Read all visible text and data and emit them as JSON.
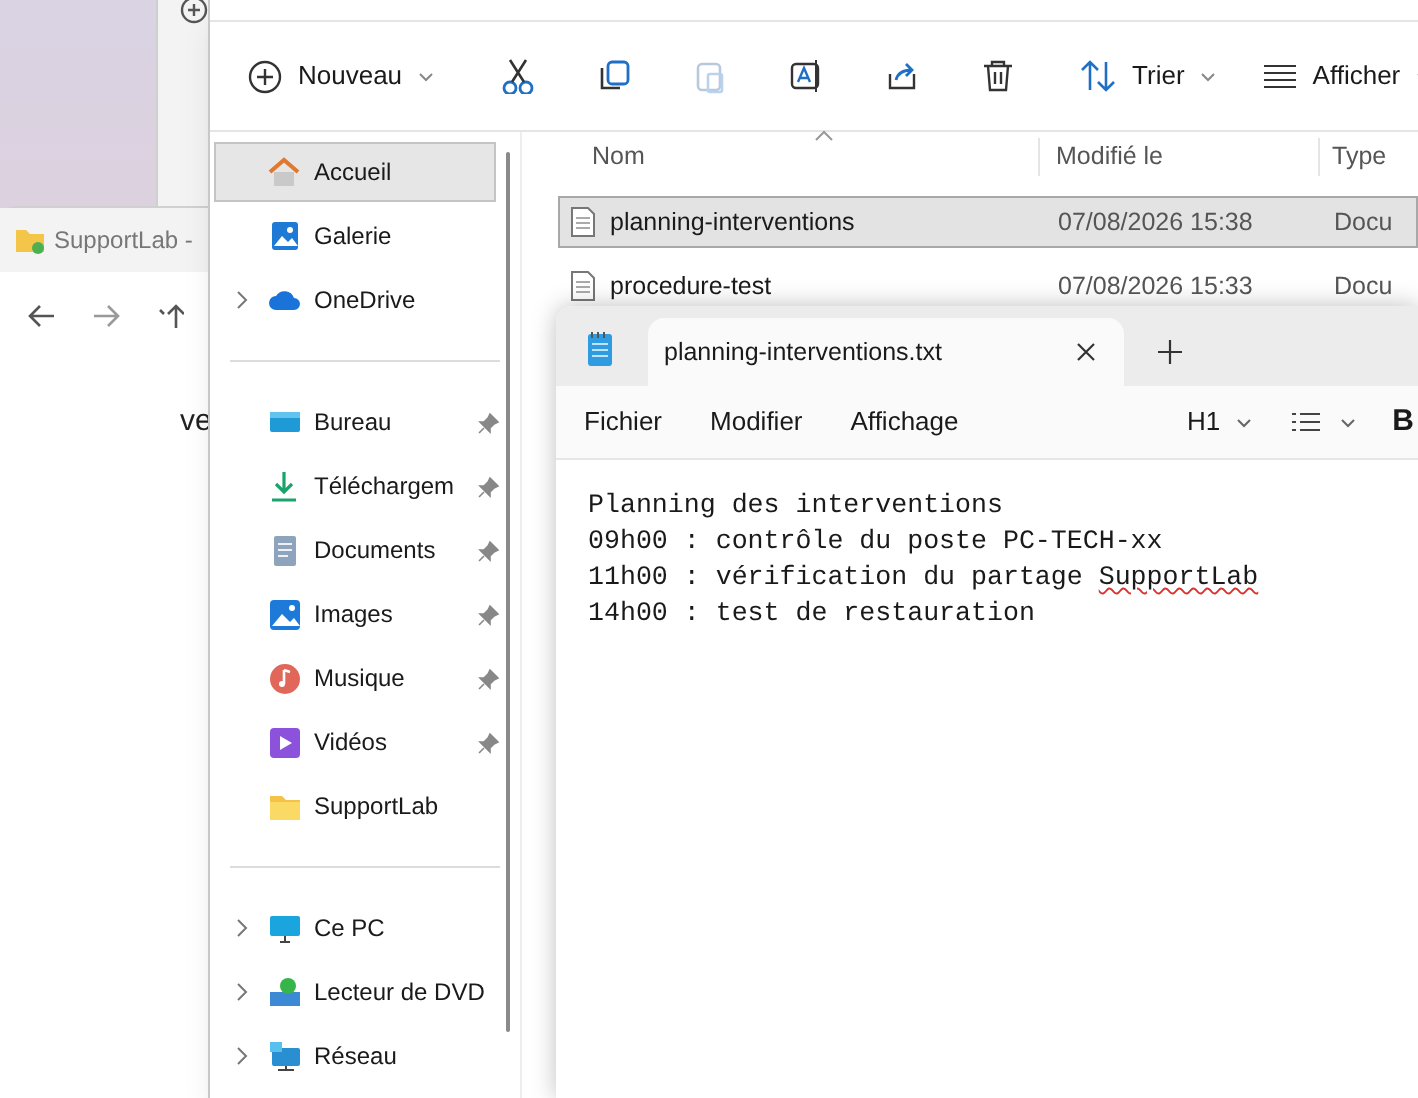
{
  "background_window": {
    "title": "SupportLab -",
    "partial_text": "ve"
  },
  "explorer": {
    "toolbar": {
      "new_label": "Nouveau",
      "sort_label": "Trier",
      "view_label": "Afficher"
    },
    "sidebar": [
      [
        {
          "label": "Accueil",
          "kind": "home",
          "selected": true,
          "pinned": false,
          "expandable": false
        },
        {
          "label": "Galerie",
          "kind": "gallery",
          "selected": false,
          "pinned": false,
          "expandable": false
        },
        {
          "label": "OneDrive",
          "kind": "cloud",
          "selected": false,
          "pinned": false,
          "expandable": true
        }
      ],
      [
        {
          "label": "Bureau",
          "kind": "desktop",
          "selected": false,
          "pinned": true,
          "expandable": false
        },
        {
          "label": "Téléchargem",
          "kind": "download",
          "selected": false,
          "pinned": true,
          "expandable": false
        },
        {
          "label": "Documents",
          "kind": "document",
          "selected": false,
          "pinned": true,
          "expandable": false
        },
        {
          "label": "Images",
          "kind": "picture",
          "selected": false,
          "pinned": true,
          "expandable": false
        },
        {
          "label": "Musique",
          "kind": "music",
          "selected": false,
          "pinned": true,
          "expandable": false
        },
        {
          "label": "Vidéos",
          "kind": "video",
          "selected": false,
          "pinned": true,
          "expandable": false
        },
        {
          "label": "SupportLab",
          "kind": "folder",
          "selected": false,
          "pinned": false,
          "expandable": false
        }
      ],
      [
        {
          "label": "Ce PC",
          "kind": "monitor",
          "selected": false,
          "pinned": false,
          "expandable": true
        },
        {
          "label": "Lecteur de DVD",
          "kind": "dvd",
          "selected": false,
          "pinned": false,
          "expandable": true
        },
        {
          "label": "Réseau",
          "kind": "network",
          "selected": false,
          "pinned": false,
          "expandable": true
        }
      ]
    ],
    "columns": [
      "Nom",
      "Modifié le",
      "Type"
    ],
    "rows": [
      {
        "name": "planning-interventions",
        "modified": "07/08/2026 15:38",
        "type": "Docu",
        "selected": true
      },
      {
        "name": "procedure-test",
        "modified": "07/08/2026 15:33",
        "type": "Docu",
        "selected": false
      }
    ]
  },
  "notepad": {
    "tab_title": "planning-interventions.txt",
    "menu": [
      "Fichier",
      "Modifier",
      "Affichage"
    ],
    "heading_format": "H1",
    "partial_button": "B",
    "lines": [
      [
        {
          "text": "Planning des interventions",
          "spell_error": false
        }
      ],
      [
        {
          "text": "09h00 : contrôle du poste PC-TECH-xx",
          "spell_error": false
        }
      ],
      [
        {
          "text": "11h00 : vérification du partage ",
          "spell_error": false
        },
        {
          "text": "SupportLab",
          "spell_error": true
        }
      ],
      [
        {
          "text": "14h00 : test de restauration",
          "spell_error": false
        }
      ]
    ]
  }
}
